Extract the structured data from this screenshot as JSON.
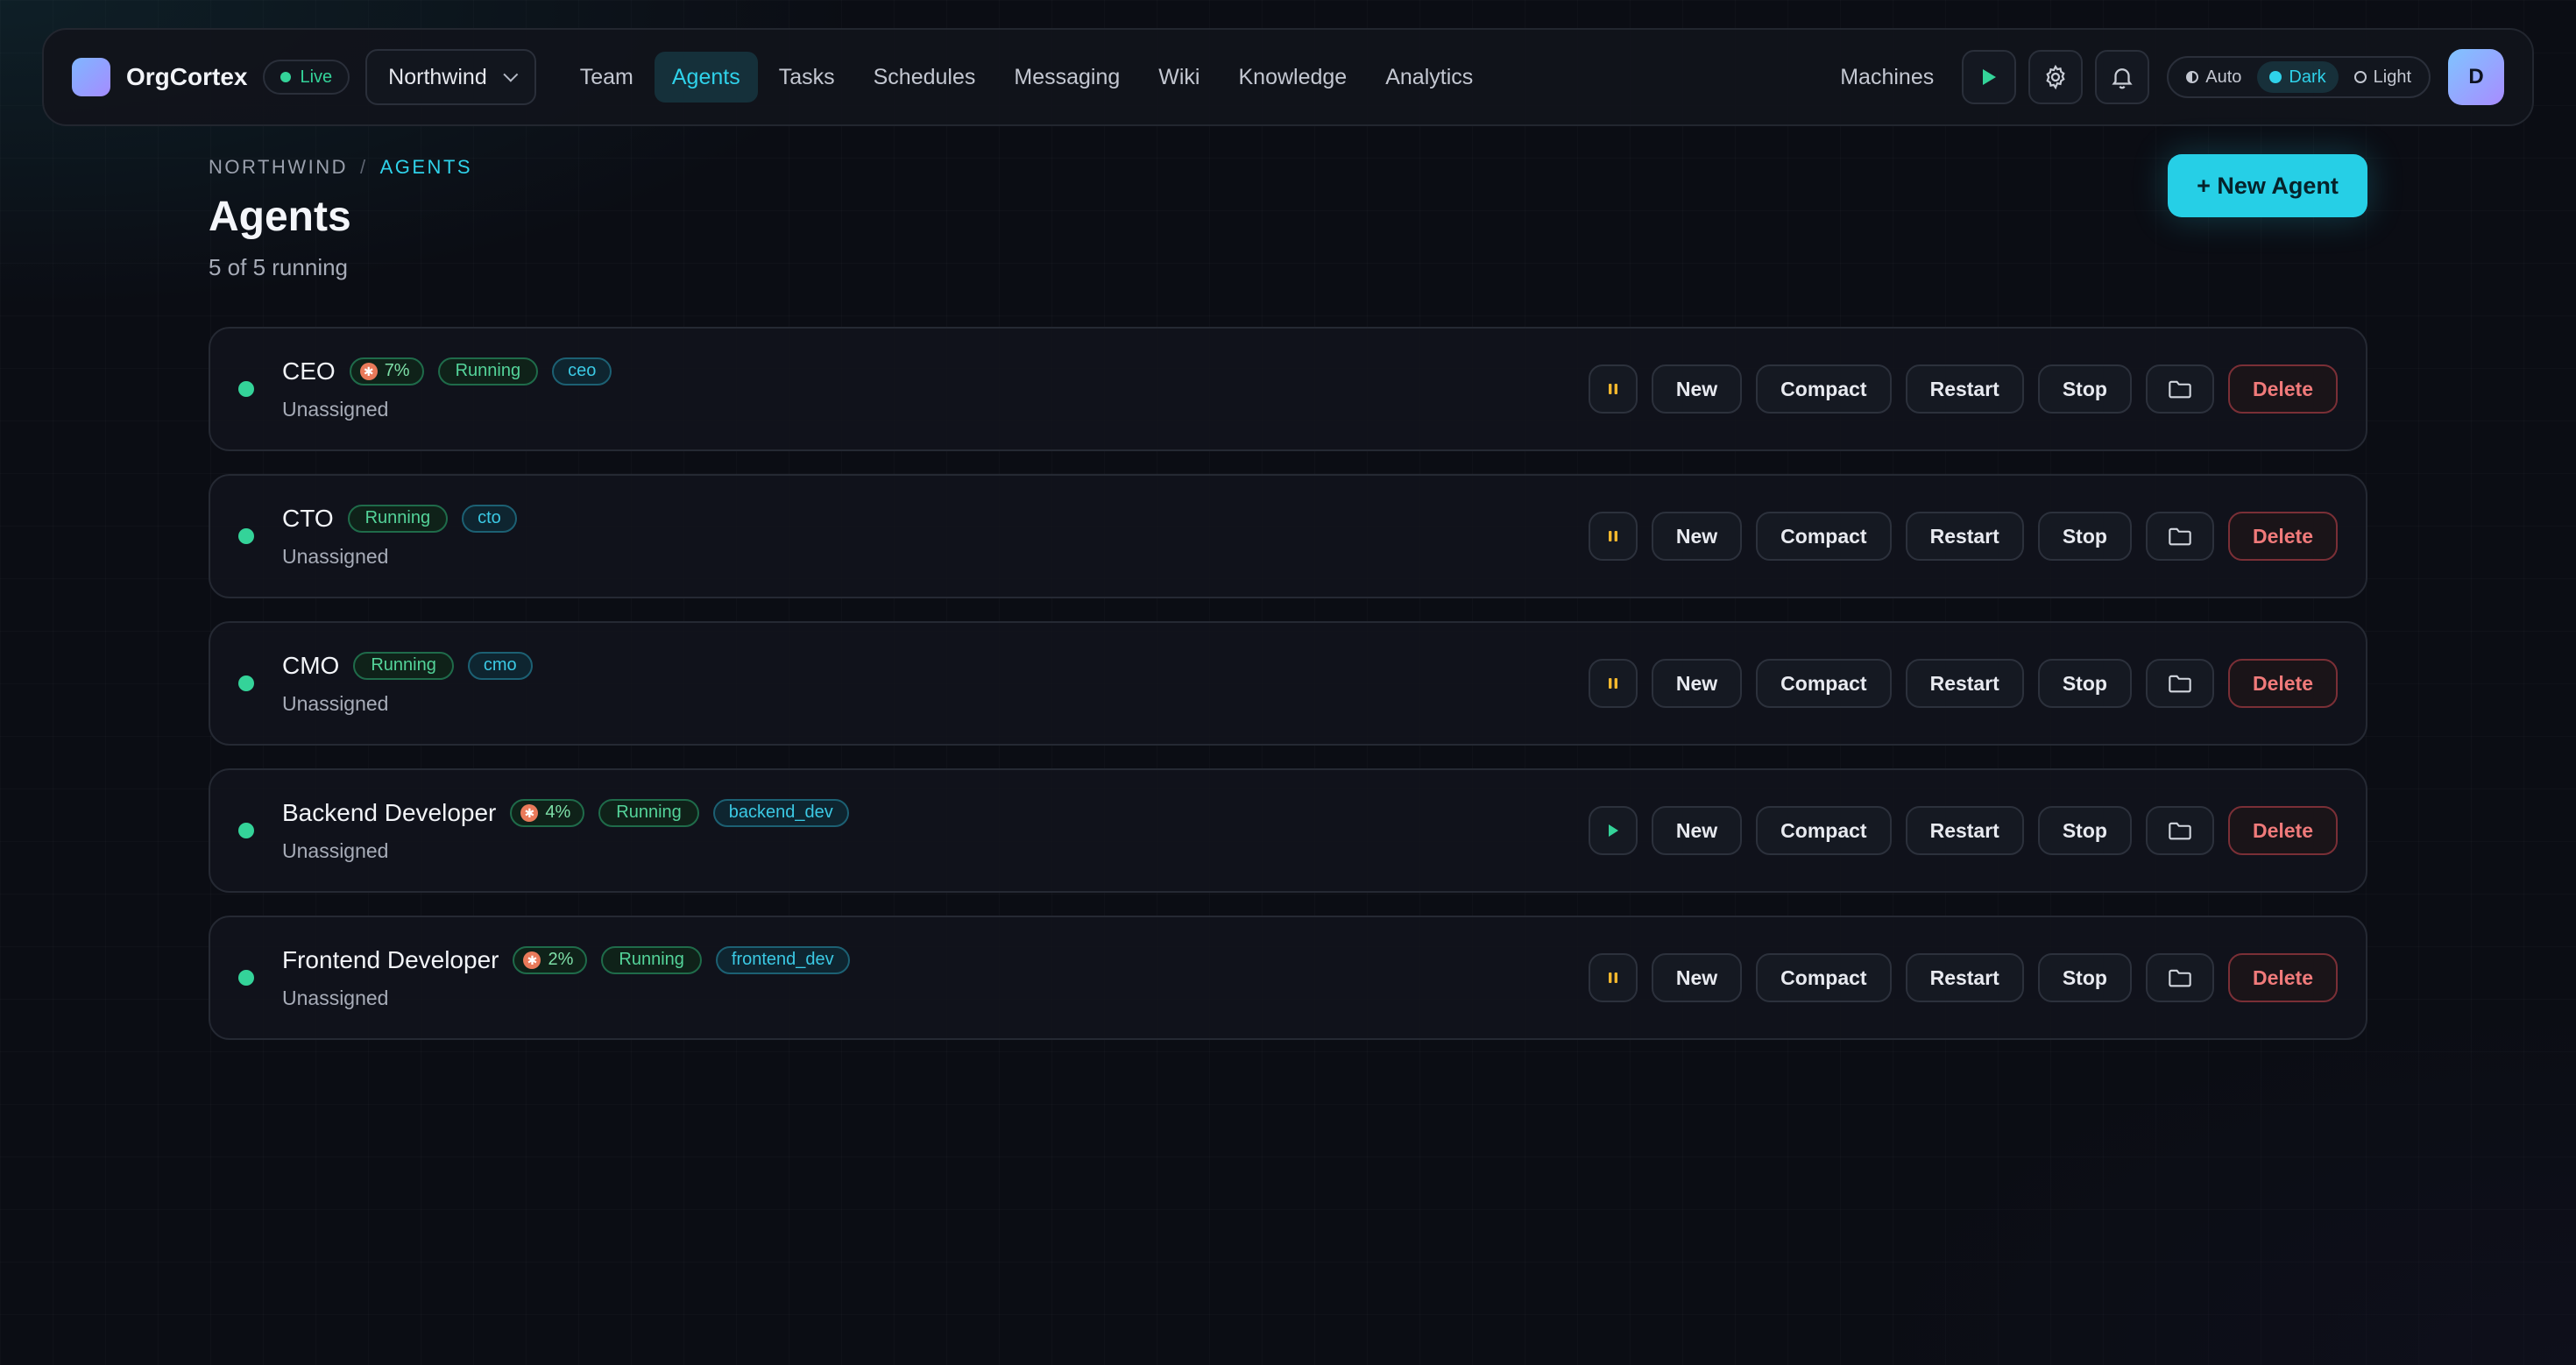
{
  "app": {
    "brand": "OrgCortex",
    "live_label": "Live",
    "org_name": "Northwind"
  },
  "nav": {
    "links": [
      "Team",
      "Agents",
      "Tasks",
      "Schedules",
      "Messaging",
      "Wiki",
      "Knowledge",
      "Analytics"
    ],
    "active": "Agents",
    "machines_label": "Machines",
    "theme_options": [
      "Auto",
      "Dark",
      "Light"
    ],
    "theme_active": "Dark",
    "avatar_initial": "D"
  },
  "page": {
    "breadcrumb_org": "NORTHWIND",
    "breadcrumb_sep": "/",
    "breadcrumb_current": "AGENTS",
    "title": "Agents",
    "subtitle": "5 of 5 running",
    "new_agent_label": "+ New Agent"
  },
  "actions": {
    "new": "New",
    "compact": "Compact",
    "restart": "Restart",
    "stop": "Stop",
    "delete": "Delete"
  },
  "agents": [
    {
      "name": "CEO",
      "usage": "7%",
      "state": "Running",
      "role": "ceo",
      "assignment": "Unassigned",
      "control": "pause"
    },
    {
      "name": "CTO",
      "usage": null,
      "state": "Running",
      "role": "cto",
      "assignment": "Unassigned",
      "control": "pause"
    },
    {
      "name": "CMO",
      "usage": null,
      "state": "Running",
      "role": "cmo",
      "assignment": "Unassigned",
      "control": "pause"
    },
    {
      "name": "Backend Developer",
      "usage": "4%",
      "state": "Running",
      "role": "backend_dev",
      "assignment": "Unassigned",
      "control": "play"
    },
    {
      "name": "Frontend Developer",
      "usage": "2%",
      "state": "Running",
      "role": "frontend_dev",
      "assignment": "Unassigned",
      "control": "pause"
    }
  ],
  "colors": {
    "accent": "#26cfe6",
    "running": "#34d399",
    "danger": "#f07a7a",
    "pause": "#f5b82e"
  }
}
